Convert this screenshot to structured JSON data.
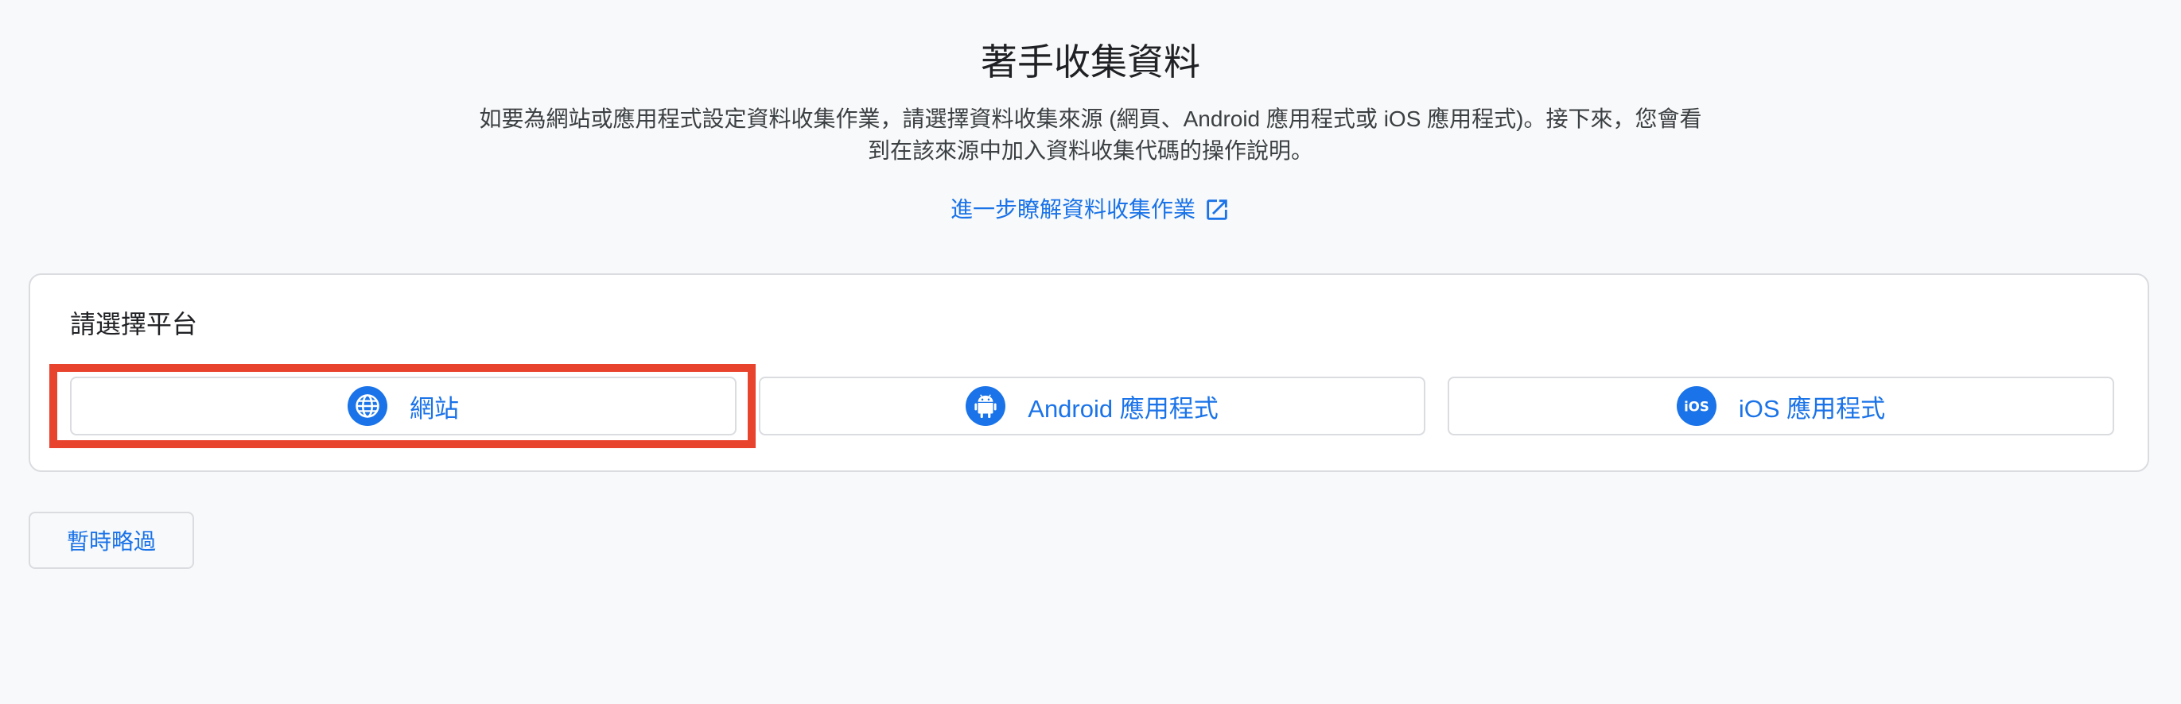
{
  "header": {
    "title": "著手收集資料",
    "description_line1": "如要為網站或應用程式設定資料收集作業，請選擇資料收集來源 (網頁、Android 應用程式或 iOS 應用程式)。接下來，您會看",
    "description_line2": "到在該來源中加入資料收集代碼的操作說明。",
    "learn_more_link": "進一步瞭解資料收集作業"
  },
  "platform_panel": {
    "heading": "請選擇平台",
    "options": [
      {
        "label": "網站",
        "icon": "globe-icon"
      },
      {
        "label": "Android 應用程式",
        "icon": "android-icon"
      },
      {
        "label": "iOS 應用程式",
        "icon": "ios-icon"
      }
    ],
    "highlighted_option": "網站"
  },
  "actions": {
    "skip_label": "暫時略過"
  },
  "colors": {
    "accent": "#1a73e8",
    "highlight": "#e8432d",
    "background": "#f8f9fa",
    "border": "#dadce0"
  }
}
